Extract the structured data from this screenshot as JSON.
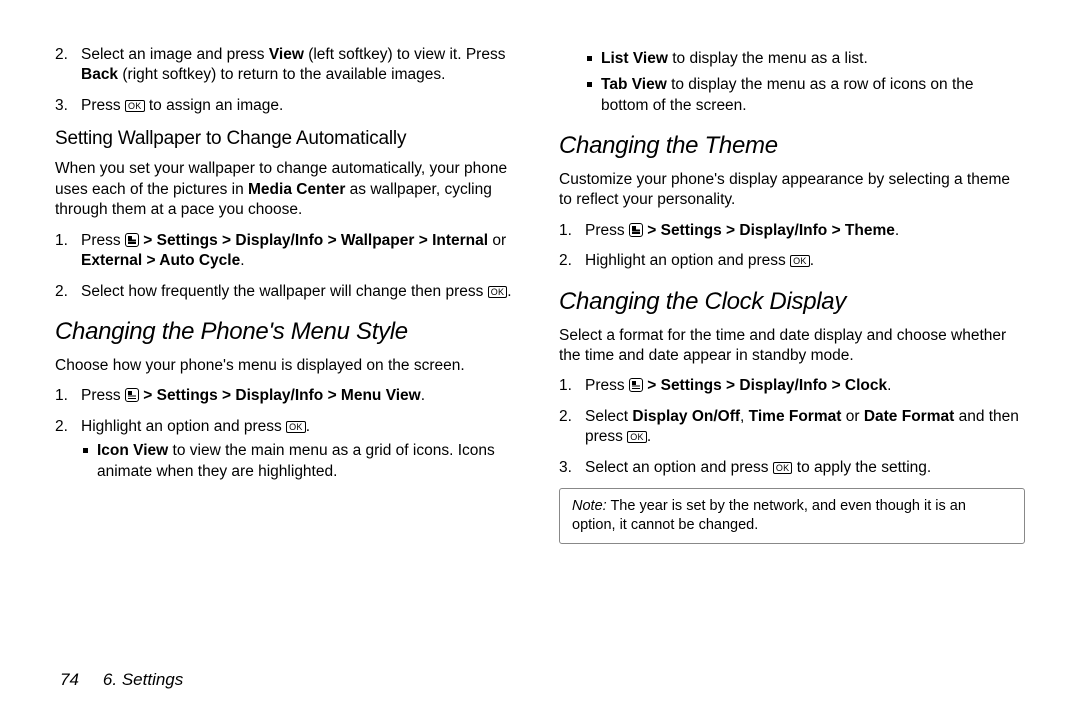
{
  "left": {
    "step2": {
      "num": "2.",
      "pre": "Select an image and press ",
      "b1": "View",
      "mid1": " (left softkey) to view it. Press ",
      "b2": "Back",
      "post": " (right softkey) to return to the available images."
    },
    "step3": {
      "num": "3.",
      "pre": "Press ",
      "post": " to assign an image.",
      "ok": "OK"
    },
    "h3": "Setting Wallpaper to Change Automatically",
    "para1": {
      "pre": "When you set your wallpaper to change automatically, your phone uses each of the pictures in ",
      "b": "Media Center",
      "post": " as wallpaper, cycling through them at a pace you choose."
    },
    "s1": {
      "num": "1.",
      "pre": "Press ",
      "path": " > Settings > Display/Info > Wallpaper > Internal ",
      "or": "or",
      "path2": " External > Auto Cycle",
      "dot": "."
    },
    "s2": {
      "num": "2.",
      "pre": "Select how frequently the wallpaper will change then press ",
      "ok": "OK",
      "post": "."
    },
    "h2": "Changing the Phone's Menu Style",
    "para2": "Choose how your phone's menu is displayed on the screen.",
    "m1": {
      "num": "1.",
      "pre": "Press ",
      "path": " > Settings > Display/Info > Menu View",
      "dot": "."
    },
    "m2": {
      "num": "2.",
      "pre": "Highlight an option and press ",
      "ok": "OK",
      "post": "."
    },
    "iconview": {
      "b": "Icon View",
      "text": " to view the main menu as a grid of icons. Icons animate when they are highlighted."
    }
  },
  "right": {
    "listview": {
      "b": "List View",
      "text": " to display the menu as a list."
    },
    "tabview": {
      "b": "Tab View",
      "text": " to display the menu as a row of icons on the bottom of the screen."
    },
    "h2a": "Changing the Theme",
    "para_a": "Customize your phone's display appearance by selecting a theme to reflect your personality.",
    "t1": {
      "num": "1.",
      "pre": "Press ",
      "path": " > Settings > Display/Info > Theme",
      "dot": "."
    },
    "t2": {
      "num": "2.",
      "pre": "Highlight an option and press ",
      "ok": "OK",
      "post": "."
    },
    "h2b": "Changing the Clock Display",
    "para_b": "Select a format for the time and date display and choose whether the time and date appear in standby mode.",
    "c1": {
      "num": "1.",
      "pre": "Press ",
      "path": " > Settings > Display/Info > Clock",
      "dot": "."
    },
    "c2": {
      "num": "2.",
      "pre": "Select ",
      "b1": "Display On/Off",
      "sep1": ", ",
      "b2": "Time Format",
      "sep2": " or ",
      "b3": "Date Format",
      "post": " and then press ",
      "ok": "OK",
      "post2": "."
    },
    "c3": {
      "num": "3.",
      "pre": "Select an option and press ",
      "ok": "OK",
      "post": " to apply the setting."
    },
    "note": {
      "label": "Note:",
      "text": "  The year is set by the network, and even though it is an option, it cannot be changed."
    }
  },
  "footer": {
    "page": "74",
    "section": "6. Settings"
  }
}
